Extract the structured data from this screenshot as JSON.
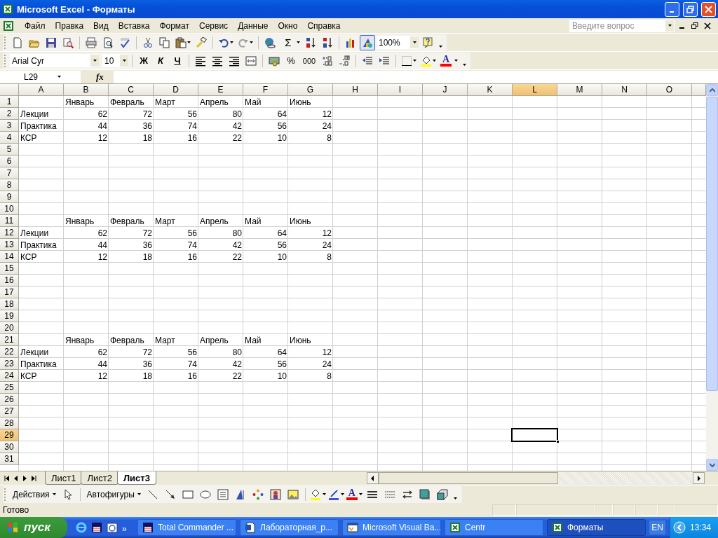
{
  "window": {
    "title": "Microsoft Excel - Форматы"
  },
  "menu": [
    "Файл",
    "Правка",
    "Вид",
    "Вставка",
    "Формат",
    "Сервис",
    "Данные",
    "Окно",
    "Справка"
  ],
  "help_box": {
    "placeholder": "Введите вопрос"
  },
  "standard_toolbar": {
    "autosum": "Σ",
    "drawing_pressed": true,
    "zoom": "100%"
  },
  "formatting_toolbar": {
    "font": "Arial Cyr",
    "size": "10",
    "bold": "Ж",
    "italic": "К",
    "underline": "Ч",
    "percent": "%",
    "thousands": "000",
    "font_color": "A"
  },
  "formula_bar": {
    "name_box": "L29",
    "function_button": "fx"
  },
  "sheet": {
    "columns": [
      {
        "label": "A",
        "selected": false
      },
      {
        "label": "B",
        "selected": false
      },
      {
        "label": "C",
        "selected": false
      },
      {
        "label": "D",
        "selected": false
      },
      {
        "label": "E",
        "selected": false
      },
      {
        "label": "F",
        "selected": false
      },
      {
        "label": "G",
        "selected": false
      },
      {
        "label": "H",
        "selected": false
      },
      {
        "label": "I",
        "selected": false
      },
      {
        "label": "J",
        "selected": false
      },
      {
        "label": "K",
        "selected": false
      },
      {
        "label": "L",
        "selected": true
      },
      {
        "label": "M",
        "selected": false
      },
      {
        "label": "N",
        "selected": false
      },
      {
        "label": "O",
        "selected": false
      }
    ],
    "rows": [
      {
        "number": "1",
        "selected": false,
        "months": [
          "Январь",
          "Февраль",
          "Март",
          "Апрель",
          "Май",
          "Июнь"
        ]
      },
      {
        "number": "2",
        "selected": false,
        "label": "Лекции",
        "values": [
          "62",
          "72",
          "56",
          "80",
          "64",
          "12"
        ]
      },
      {
        "number": "3",
        "selected": false,
        "label": "Практика",
        "values": [
          "44",
          "36",
          "74",
          "42",
          "56",
          "24"
        ]
      },
      {
        "number": "4",
        "selected": false,
        "label": "КСР",
        "values": [
          "12",
          "18",
          "16",
          "22",
          "10",
          "8"
        ]
      },
      {
        "number": "5",
        "selected": false
      },
      {
        "number": "6",
        "selected": false
      },
      {
        "number": "7",
        "selected": false
      },
      {
        "number": "8",
        "selected": false
      },
      {
        "number": "9",
        "selected": false
      },
      {
        "number": "10",
        "selected": false
      },
      {
        "number": "11",
        "selected": false,
        "months": [
          "Январь",
          "Февраль",
          "Март",
          "Апрель",
          "Май",
          "Июнь"
        ]
      },
      {
        "number": "12",
        "selected": false,
        "label": "Лекции",
        "values": [
          "62",
          "72",
          "56",
          "80",
          "64",
          "12"
        ]
      },
      {
        "number": "13",
        "selected": false,
        "label": "Практика",
        "values": [
          "44",
          "36",
          "74",
          "42",
          "56",
          "24"
        ]
      },
      {
        "number": "14",
        "selected": false,
        "label": "КСР",
        "values": [
          "12",
          "18",
          "16",
          "22",
          "10",
          "8"
        ]
      },
      {
        "number": "15",
        "selected": false
      },
      {
        "number": "16",
        "selected": false
      },
      {
        "number": "17",
        "selected": false
      },
      {
        "number": "18",
        "selected": false
      },
      {
        "number": "19",
        "selected": false
      },
      {
        "number": "20",
        "selected": false
      },
      {
        "number": "21",
        "selected": false,
        "months": [
          "Январь",
          "Февраль",
          "Март",
          "Апрель",
          "Май",
          "Июнь"
        ]
      },
      {
        "number": "22",
        "selected": false,
        "label": "Лекции",
        "values": [
          "62",
          "72",
          "56",
          "80",
          "64",
          "12"
        ]
      },
      {
        "number": "23",
        "selected": false,
        "label": "Практика",
        "values": [
          "44",
          "36",
          "74",
          "42",
          "56",
          "24"
        ]
      },
      {
        "number": "24",
        "selected": false,
        "label": "КСР",
        "values": [
          "12",
          "18",
          "16",
          "22",
          "10",
          "8"
        ]
      },
      {
        "number": "25",
        "selected": false
      },
      {
        "number": "26",
        "selected": false
      },
      {
        "number": "27",
        "selected": false
      },
      {
        "number": "28",
        "selected": false
      },
      {
        "number": "29",
        "selected": true
      },
      {
        "number": "30",
        "selected": false
      },
      {
        "number": "31",
        "selected": false
      }
    ]
  },
  "sheet_tabs": [
    {
      "label": "Лист1",
      "selected": false
    },
    {
      "label": "Лист2",
      "selected": false
    },
    {
      "label": "Лист3",
      "selected": true
    }
  ],
  "drawing_toolbar": {
    "actions": "Действия",
    "autoshapes": "Автофигуры",
    "font_color": "A"
  },
  "status_bar": {
    "text": "Готово"
  },
  "taskbar": {
    "start": "пуск",
    "quick_launch_more": "»",
    "tasks": [
      {
        "label": "Total Commander ...",
        "kind": "commander",
        "selected": false
      },
      {
        "label": "Лабораторная_р...",
        "kind": "word",
        "selected": false
      },
      {
        "label": "Microsoft Visual Ba...",
        "kind": "vba",
        "selected": false
      },
      {
        "label": "Centr",
        "kind": "excel",
        "selected": false
      },
      {
        "label": "Форматы",
        "kind": "excel",
        "selected": true
      }
    ],
    "language": "EN",
    "clock": "13:34"
  }
}
